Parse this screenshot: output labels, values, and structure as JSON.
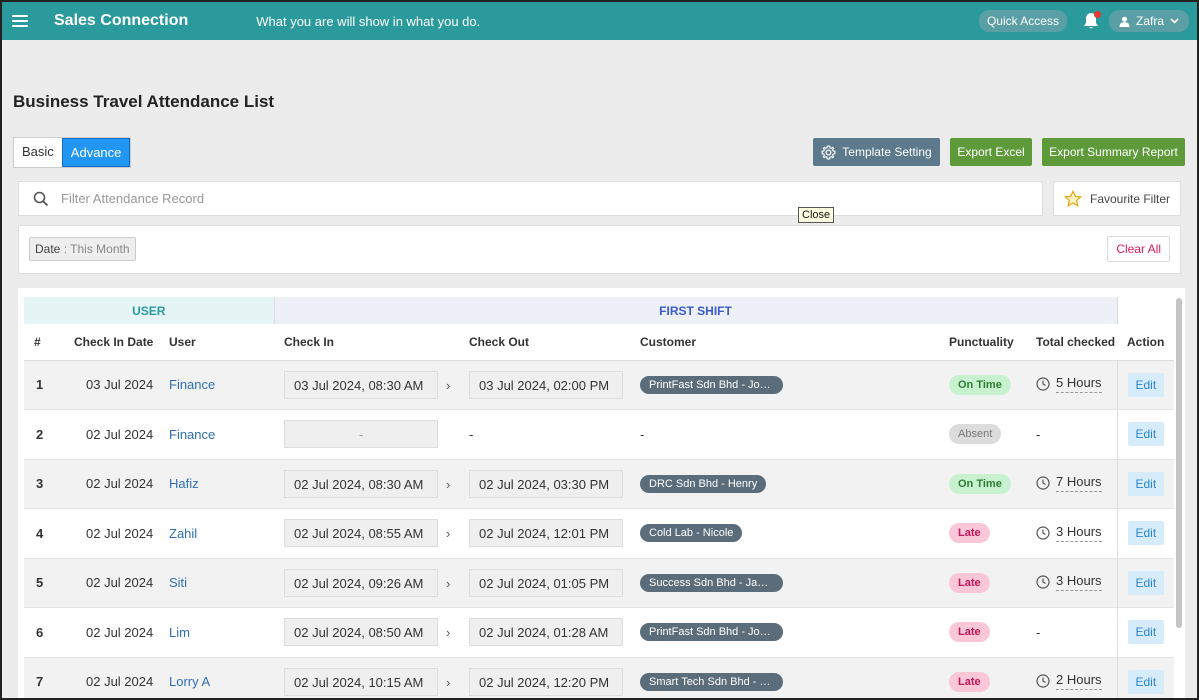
{
  "header": {
    "brand": "Sales Connection",
    "tagline": "What you are will show in what you do.",
    "quick_access": "Quick Access",
    "user_name": "Zafra"
  },
  "page": {
    "title": "Business Travel Attendance List"
  },
  "mode_tabs": {
    "basic": "Basic",
    "advance": "Advance",
    "active": "Advance"
  },
  "toolbar": {
    "template_setting": "Template Setting",
    "export_excel": "Export Excel",
    "export_summary": "Export Summary Report"
  },
  "filter": {
    "placeholder": "Filter Attendance Record",
    "favourite": "Favourite Filter",
    "tooltip": "Close",
    "chip_label": "Date",
    "chip_sep": " : ",
    "chip_value": "This Month",
    "clear_all": "Clear All"
  },
  "table": {
    "group_user": "USER",
    "group_shift": "FIRST SHIFT",
    "columns": {
      "num": "#",
      "check_in_date": "Check In Date",
      "user": "User",
      "check_in": "Check In",
      "check_out": "Check Out",
      "customer": "Customer",
      "punctuality": "Punctuality",
      "total_checked": "Total checked",
      "action": "Action"
    },
    "edit_label": "Edit",
    "rows": [
      {
        "num": "1",
        "date": "03 Jul 2024",
        "user": "Finance",
        "check_in": "03 Jul 2024, 08:30 AM",
        "check_out": "03 Jul 2024, 02:00 PM",
        "customer": "PrintFast Sdn Bhd - Joh...",
        "punctuality": "On Time",
        "hours": "5 Hours"
      },
      {
        "num": "2",
        "date": "02 Jul 2024",
        "user": "Finance",
        "check_in": "-",
        "check_out": "-",
        "customer": "-",
        "punctuality": "Absent",
        "hours": "-"
      },
      {
        "num": "3",
        "date": "02 Jul 2024",
        "user": "Hafiz",
        "check_in": "02 Jul 2024, 08:30 AM",
        "check_out": "02 Jul 2024, 03:30 PM",
        "customer": "DRC Sdn Bhd - Henry",
        "punctuality": "On Time",
        "hours": "7 Hours"
      },
      {
        "num": "4",
        "date": "02 Jul 2024",
        "user": "Zahil",
        "check_in": "02 Jul 2024, 08:55 AM",
        "check_out": "02 Jul 2024, 12:01 PM",
        "customer": "Cold Lab - Nicole",
        "punctuality": "Late",
        "hours": "3 Hours"
      },
      {
        "num": "5",
        "date": "02 Jul 2024",
        "user": "Siti",
        "check_in": "02 Jul 2024, 09:26 AM",
        "check_out": "02 Jul 2024, 01:05 PM",
        "customer": "Success Sdn Bhd - Jam...",
        "punctuality": "Late",
        "hours": "3 Hours"
      },
      {
        "num": "6",
        "date": "02 Jul 2024",
        "user": "Lim",
        "check_in": "02 Jul 2024, 08:50 AM",
        "check_out": "02 Jul 2024, 01:28 AM",
        "customer": "PrintFast Sdn Bhd - Joh...",
        "punctuality": "Late",
        "hours": "-"
      },
      {
        "num": "7",
        "date": "02 Jul 2024",
        "user": "Lorry A",
        "check_in": "02 Jul 2024, 10:15 AM",
        "check_out": "02 Jul 2024, 12:20 PM",
        "customer": "Smart Tech Sdn Bhd - J...",
        "punctuality": "Late",
        "hours": "2 Hours"
      }
    ]
  }
}
